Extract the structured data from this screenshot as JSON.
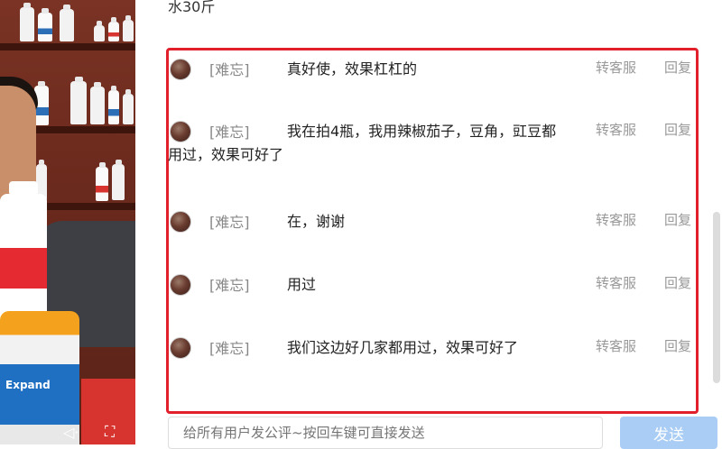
{
  "video": {
    "product_label": "Expand",
    "controls": {
      "volume_icon": "speaker-icon",
      "fullscreen_icon": "fullscreen-icon",
      "volume_glyph": "◁·",
      "fullscreen_glyph": "⛶"
    }
  },
  "panel": {
    "previous_text_fragment": "水30斤",
    "comments": [
      {
        "user": "[难忘]",
        "text": "真好使，效果杠杠的",
        "transfer_label": "转客服",
        "reply_label": "回复"
      },
      {
        "user": "[难忘]",
        "text": "我在拍4瓶，我用辣椒茄子，豆角，豇豆都用过，效果可好了",
        "transfer_label": "转客服",
        "reply_label": "回复"
      },
      {
        "user": "[难忘]",
        "text": "在，谢谢",
        "transfer_label": "转客服",
        "reply_label": "回复"
      },
      {
        "user": "[难忘]",
        "text": "用过",
        "transfer_label": "转客服",
        "reply_label": "回复"
      },
      {
        "user": "[难忘]",
        "text": "我们这边好几家都用过，效果可好了",
        "transfer_label": "转客服",
        "reply_label": "回复"
      }
    ],
    "input": {
      "placeholder": "给所有用户发公评~按回车键可直接发送",
      "value": ""
    },
    "send_label": "发送"
  },
  "colors": {
    "highlight_border": "#e2202b",
    "send_button": "#a9cdf4",
    "username": "#888888",
    "action": "#999999"
  }
}
